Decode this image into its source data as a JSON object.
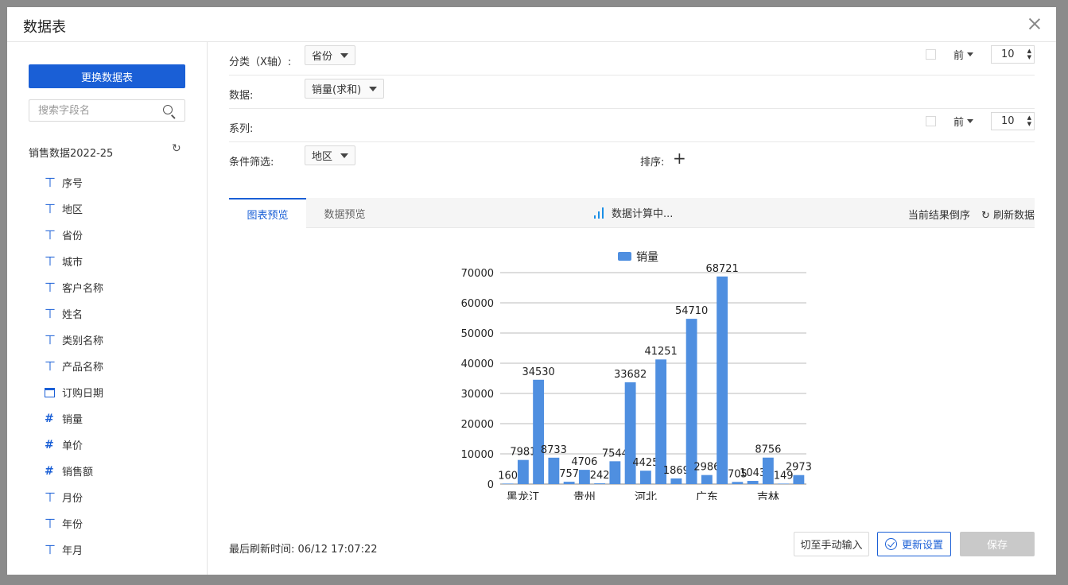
{
  "dialog": {
    "title": "数据表"
  },
  "sidebar": {
    "change_button": "更换数据表",
    "search_placeholder": "搜索字段名",
    "dataset_name": "销售数据2022-25",
    "fields": [
      {
        "label": "序号",
        "type": "text"
      },
      {
        "label": "地区",
        "type": "text"
      },
      {
        "label": "省份",
        "type": "text"
      },
      {
        "label": "城市",
        "type": "text"
      },
      {
        "label": "客户名称",
        "type": "text"
      },
      {
        "label": "姓名",
        "type": "text"
      },
      {
        "label": "类别名称",
        "type": "text"
      },
      {
        "label": "产品名称",
        "type": "text"
      },
      {
        "label": "订购日期",
        "type": "date"
      },
      {
        "label": "销量",
        "type": "number"
      },
      {
        "label": "单价",
        "type": "number"
      },
      {
        "label": "销售额",
        "type": "number"
      },
      {
        "label": "月份",
        "type": "text"
      },
      {
        "label": "年份",
        "type": "text"
      },
      {
        "label": "年月",
        "type": "text"
      }
    ]
  },
  "config": {
    "category_label": "分类（X轴）:",
    "category_value": "省份",
    "data_label": "数据:",
    "data_value": "销量(求和)",
    "series_label": "系列:",
    "filter_label": "条件筛选:",
    "filter_value": "地区",
    "sort_label": "排序:",
    "topn_label": "前",
    "topn_value": "10",
    "series_topn_label": "前",
    "series_topn_value": "10"
  },
  "tabs": {
    "chart_preview": "图表预览",
    "data_preview": "数据预览",
    "loading_text": "数据计算中...",
    "reverse_label": "当前结果倒序",
    "refresh_label": "刷新数据"
  },
  "footer": {
    "last_refresh": "最后刷新时间: 06/12 17:07:22",
    "manual_button": "切至手动输入",
    "update_button": "更新设置",
    "save_button": "保存"
  },
  "colors": {
    "accent": "#1a5fd6",
    "bar": "#4f8fe0"
  },
  "chart_data": {
    "type": "bar",
    "legend": [
      "销量"
    ],
    "legend_position": "top-center",
    "ylim": [
      0,
      70000
    ],
    "yticks": [
      0,
      10000,
      20000,
      30000,
      40000,
      50000,
      60000,
      70000
    ],
    "xtick_labels": [
      "黑龙江",
      "贵州",
      "河北",
      "广东",
      "吉林"
    ],
    "grid": true,
    "series": [
      {
        "name": "销量",
        "values": [
          160,
          7981,
          34530,
          8733,
          757,
          4706,
          242,
          7544,
          33682,
          4425,
          41251,
          1869,
          54710,
          2986,
          68721,
          705,
          1043,
          8756,
          149,
          2973
        ]
      }
    ]
  }
}
